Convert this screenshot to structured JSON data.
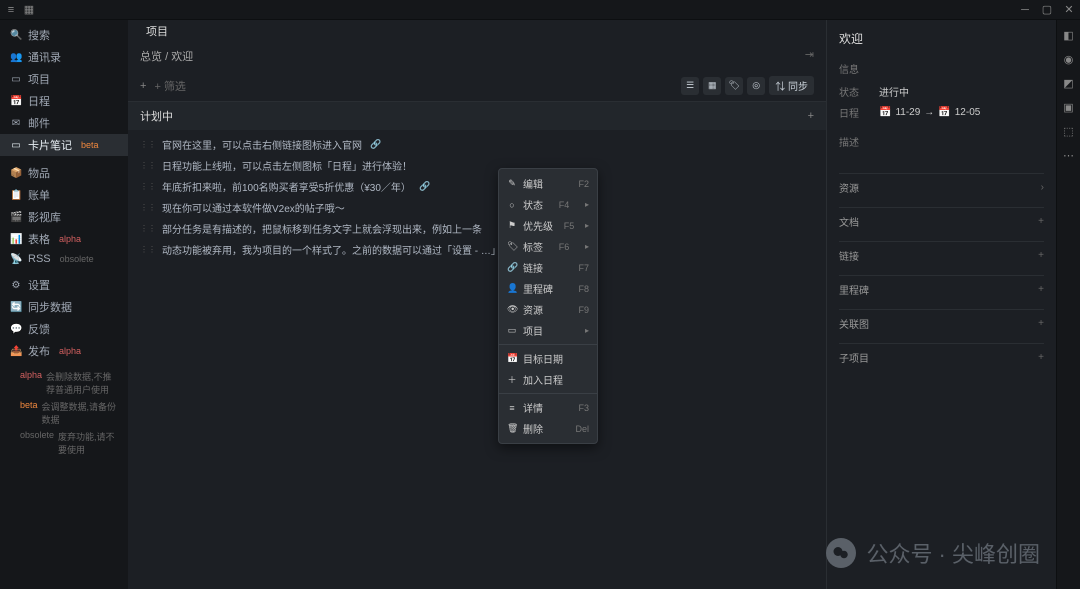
{
  "titlebar": {
    "menu_icon": "≡",
    "app_icon": "▦"
  },
  "sidebar": {
    "items": [
      {
        "icon": "search",
        "label": "搜索"
      },
      {
        "icon": "contacts",
        "label": "通讯录"
      },
      {
        "icon": "project",
        "label": "项目"
      },
      {
        "icon": "calendar",
        "label": "日程"
      },
      {
        "icon": "mail",
        "label": "邮件"
      },
      {
        "icon": "card",
        "label": "卡片笔记",
        "badge": "beta"
      },
      {
        "icon": "box",
        "label": "物品"
      },
      {
        "icon": "ledger",
        "label": "账单"
      },
      {
        "icon": "video",
        "label": "影视库"
      },
      {
        "icon": "chart",
        "label": "表格",
        "badge": "alpha"
      },
      {
        "icon": "rss",
        "label": "RSS",
        "badge": "obsolete"
      },
      {
        "icon": "settings",
        "label": "设置"
      },
      {
        "icon": "sync",
        "label": "同步数据"
      },
      {
        "icon": "feedback",
        "label": "反馈"
      },
      {
        "icon": "publish",
        "label": "发布",
        "badge": "alpha"
      }
    ],
    "notes": [
      {
        "tag": "alpha",
        "text": "会删除数据,不推荐普通用户使用"
      },
      {
        "tag": "beta",
        "text": "会调整数据,请备份数据"
      },
      {
        "tag": "obsolete",
        "text": "废弃功能,请不要使用"
      }
    ]
  },
  "tabbar": {
    "tab1": "项目"
  },
  "breadcrumb": {
    "path1": "总览",
    "sep": "/",
    "path2": "欢迎"
  },
  "filterbar": {
    "add": "+",
    "filter_placeholder": "+ 筛选",
    "sync": "同步"
  },
  "section": {
    "title": "计划中"
  },
  "tasks": [
    {
      "text": "官网在这里，可以点击右侧链接图标进入官网",
      "link": true
    },
    {
      "text": "日程功能上线啦，可以点击左侧图标「日程」进行体验！"
    },
    {
      "text": "年底折扣来啦，前100名购买者享受5折优惠（¥30／年）",
      "link": true
    },
    {
      "text": "现在你可以通过本软件做V2ex的帖子哦～"
    },
    {
      "text": "部分任务是有描述的，把鼠标移到任务文字上就会浮现出来，例如上一条"
    },
    {
      "text": "动态功能被弃用，我为项目的一个样式了。之前的数据可以通过「设置 - …」来转移数据。"
    }
  ],
  "context_menu": {
    "items": [
      {
        "icon": "✎",
        "label": "编辑",
        "shortcut": "F2"
      },
      {
        "icon": "○",
        "label": "状态",
        "shortcut": "F4",
        "submenu": true
      },
      {
        "icon": "⚑",
        "label": "优先级",
        "shortcut": "F5",
        "submenu": true
      },
      {
        "icon": "🏷",
        "label": "标签",
        "shortcut": "F6",
        "submenu": true
      },
      {
        "icon": "🔗",
        "label": "链接",
        "shortcut": "F7"
      },
      {
        "icon": "👤",
        "label": "里程碑",
        "shortcut": "F8"
      },
      {
        "icon": "👁",
        "label": "资源",
        "shortcut": "F9"
      },
      {
        "icon": "▭",
        "label": "项目",
        "submenu": true
      },
      {
        "icon": "📅",
        "label": "目标日期"
      },
      {
        "icon": "＋",
        "label": "加入日程"
      },
      {
        "icon": "≡",
        "label": "详情",
        "shortcut": "F3"
      },
      {
        "icon": "🗑",
        "label": "删除",
        "shortcut": "Del"
      }
    ],
    "separators": [
      7,
      9
    ]
  },
  "detail": {
    "title": "欢迎",
    "info_label": "信息",
    "status_label": "状态",
    "status_value": "进行中",
    "date_label": "日程",
    "date_from": "11-29",
    "date_to": "12-05",
    "desc_label": "描述",
    "sections": [
      {
        "label": "资源",
        "type": "chevron"
      },
      {
        "label": "文档",
        "type": "plus"
      },
      {
        "label": "链接",
        "type": "plus"
      },
      {
        "label": "里程碑",
        "type": "plus"
      },
      {
        "label": "关联图",
        "type": "plus"
      },
      {
        "label": "子项目",
        "type": "plus"
      }
    ]
  },
  "watermark": {
    "text": "公众号 · 尖峰创圈"
  }
}
